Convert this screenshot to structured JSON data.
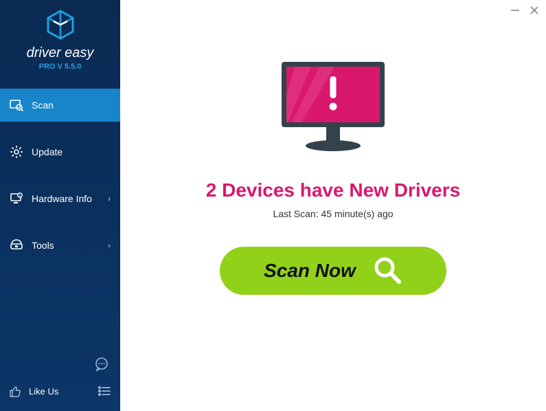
{
  "brand": {
    "name": "driver easy",
    "version": "PRO V 5.5.0"
  },
  "sidebar": {
    "items": [
      {
        "label": "Scan",
        "active": true,
        "expandable": false
      },
      {
        "label": "Update",
        "active": false,
        "expandable": false
      },
      {
        "label": "Hardware Info",
        "active": false,
        "expandable": true
      },
      {
        "label": "Tools",
        "active": false,
        "expandable": true
      }
    ],
    "like_label": "Like Us"
  },
  "main": {
    "headline": "2 Devices have New Drivers",
    "last_scan": "Last Scan: 45 minute(s) ago",
    "scan_button": "Scan Now"
  },
  "colors": {
    "accent_pink": "#d9186d",
    "accent_green": "#92d11a",
    "sidebar_active": "#1885cb"
  }
}
